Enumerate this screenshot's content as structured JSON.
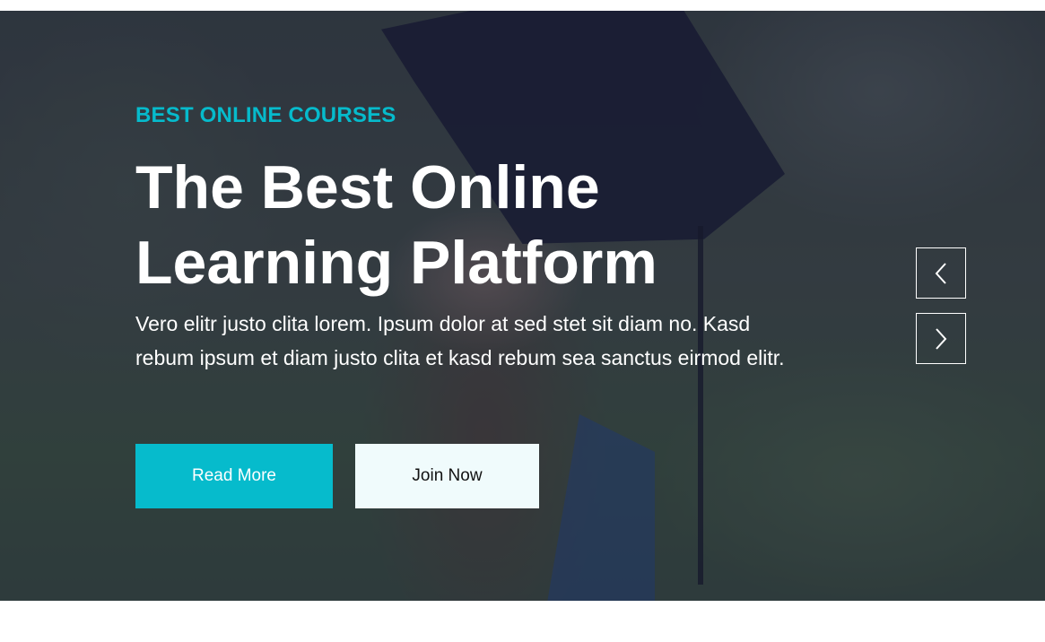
{
  "hero": {
    "eyebrow": "BEST ONLINE COURSES",
    "title": "The Best Online Learning Platform",
    "description": "Vero elitr justo clita lorem. Ipsum dolor at sed stet sit diam no. Kasd rebum ipsum et diam justo clita et kasd rebum sea sanctus eirmod elitr.",
    "primary_button": "Read More",
    "secondary_button": "Join Now"
  },
  "carousel": {
    "prev_icon": "chevron-left-icon",
    "next_icon": "chevron-right-icon"
  },
  "colors": {
    "accent": "#06bbcc",
    "light_button": "#f0fbfc",
    "text": "#ffffff"
  }
}
